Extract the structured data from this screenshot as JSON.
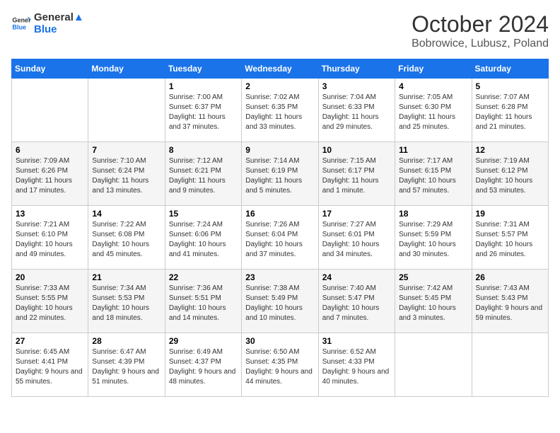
{
  "header": {
    "logo_line1": "General",
    "logo_line2": "Blue",
    "month": "October 2024",
    "location": "Bobrowice, Lubusz, Poland"
  },
  "weekdays": [
    "Sunday",
    "Monday",
    "Tuesday",
    "Wednesday",
    "Thursday",
    "Friday",
    "Saturday"
  ],
  "weeks": [
    [
      {
        "day": "",
        "info": ""
      },
      {
        "day": "",
        "info": ""
      },
      {
        "day": "1",
        "info": "Sunrise: 7:00 AM\nSunset: 6:37 PM\nDaylight: 11 hours and 37 minutes."
      },
      {
        "day": "2",
        "info": "Sunrise: 7:02 AM\nSunset: 6:35 PM\nDaylight: 11 hours and 33 minutes."
      },
      {
        "day": "3",
        "info": "Sunrise: 7:04 AM\nSunset: 6:33 PM\nDaylight: 11 hours and 29 minutes."
      },
      {
        "day": "4",
        "info": "Sunrise: 7:05 AM\nSunset: 6:30 PM\nDaylight: 11 hours and 25 minutes."
      },
      {
        "day": "5",
        "info": "Sunrise: 7:07 AM\nSunset: 6:28 PM\nDaylight: 11 hours and 21 minutes."
      }
    ],
    [
      {
        "day": "6",
        "info": "Sunrise: 7:09 AM\nSunset: 6:26 PM\nDaylight: 11 hours and 17 minutes."
      },
      {
        "day": "7",
        "info": "Sunrise: 7:10 AM\nSunset: 6:24 PM\nDaylight: 11 hours and 13 minutes."
      },
      {
        "day": "8",
        "info": "Sunrise: 7:12 AM\nSunset: 6:21 PM\nDaylight: 11 hours and 9 minutes."
      },
      {
        "day": "9",
        "info": "Sunrise: 7:14 AM\nSunset: 6:19 PM\nDaylight: 11 hours and 5 minutes."
      },
      {
        "day": "10",
        "info": "Sunrise: 7:15 AM\nSunset: 6:17 PM\nDaylight: 11 hours and 1 minute."
      },
      {
        "day": "11",
        "info": "Sunrise: 7:17 AM\nSunset: 6:15 PM\nDaylight: 10 hours and 57 minutes."
      },
      {
        "day": "12",
        "info": "Sunrise: 7:19 AM\nSunset: 6:12 PM\nDaylight: 10 hours and 53 minutes."
      }
    ],
    [
      {
        "day": "13",
        "info": "Sunrise: 7:21 AM\nSunset: 6:10 PM\nDaylight: 10 hours and 49 minutes."
      },
      {
        "day": "14",
        "info": "Sunrise: 7:22 AM\nSunset: 6:08 PM\nDaylight: 10 hours and 45 minutes."
      },
      {
        "day": "15",
        "info": "Sunrise: 7:24 AM\nSunset: 6:06 PM\nDaylight: 10 hours and 41 minutes."
      },
      {
        "day": "16",
        "info": "Sunrise: 7:26 AM\nSunset: 6:04 PM\nDaylight: 10 hours and 37 minutes."
      },
      {
        "day": "17",
        "info": "Sunrise: 7:27 AM\nSunset: 6:01 PM\nDaylight: 10 hours and 34 minutes."
      },
      {
        "day": "18",
        "info": "Sunrise: 7:29 AM\nSunset: 5:59 PM\nDaylight: 10 hours and 30 minutes."
      },
      {
        "day": "19",
        "info": "Sunrise: 7:31 AM\nSunset: 5:57 PM\nDaylight: 10 hours and 26 minutes."
      }
    ],
    [
      {
        "day": "20",
        "info": "Sunrise: 7:33 AM\nSunset: 5:55 PM\nDaylight: 10 hours and 22 minutes."
      },
      {
        "day": "21",
        "info": "Sunrise: 7:34 AM\nSunset: 5:53 PM\nDaylight: 10 hours and 18 minutes."
      },
      {
        "day": "22",
        "info": "Sunrise: 7:36 AM\nSunset: 5:51 PM\nDaylight: 10 hours and 14 minutes."
      },
      {
        "day": "23",
        "info": "Sunrise: 7:38 AM\nSunset: 5:49 PM\nDaylight: 10 hours and 10 minutes."
      },
      {
        "day": "24",
        "info": "Sunrise: 7:40 AM\nSunset: 5:47 PM\nDaylight: 10 hours and 7 minutes."
      },
      {
        "day": "25",
        "info": "Sunrise: 7:42 AM\nSunset: 5:45 PM\nDaylight: 10 hours and 3 minutes."
      },
      {
        "day": "26",
        "info": "Sunrise: 7:43 AM\nSunset: 5:43 PM\nDaylight: 9 hours and 59 minutes."
      }
    ],
    [
      {
        "day": "27",
        "info": "Sunrise: 6:45 AM\nSunset: 4:41 PM\nDaylight: 9 hours and 55 minutes."
      },
      {
        "day": "28",
        "info": "Sunrise: 6:47 AM\nSunset: 4:39 PM\nDaylight: 9 hours and 51 minutes."
      },
      {
        "day": "29",
        "info": "Sunrise: 6:49 AM\nSunset: 4:37 PM\nDaylight: 9 hours and 48 minutes."
      },
      {
        "day": "30",
        "info": "Sunrise: 6:50 AM\nSunset: 4:35 PM\nDaylight: 9 hours and 44 minutes."
      },
      {
        "day": "31",
        "info": "Sunrise: 6:52 AM\nSunset: 4:33 PM\nDaylight: 9 hours and 40 minutes."
      },
      {
        "day": "",
        "info": ""
      },
      {
        "day": "",
        "info": ""
      }
    ]
  ]
}
